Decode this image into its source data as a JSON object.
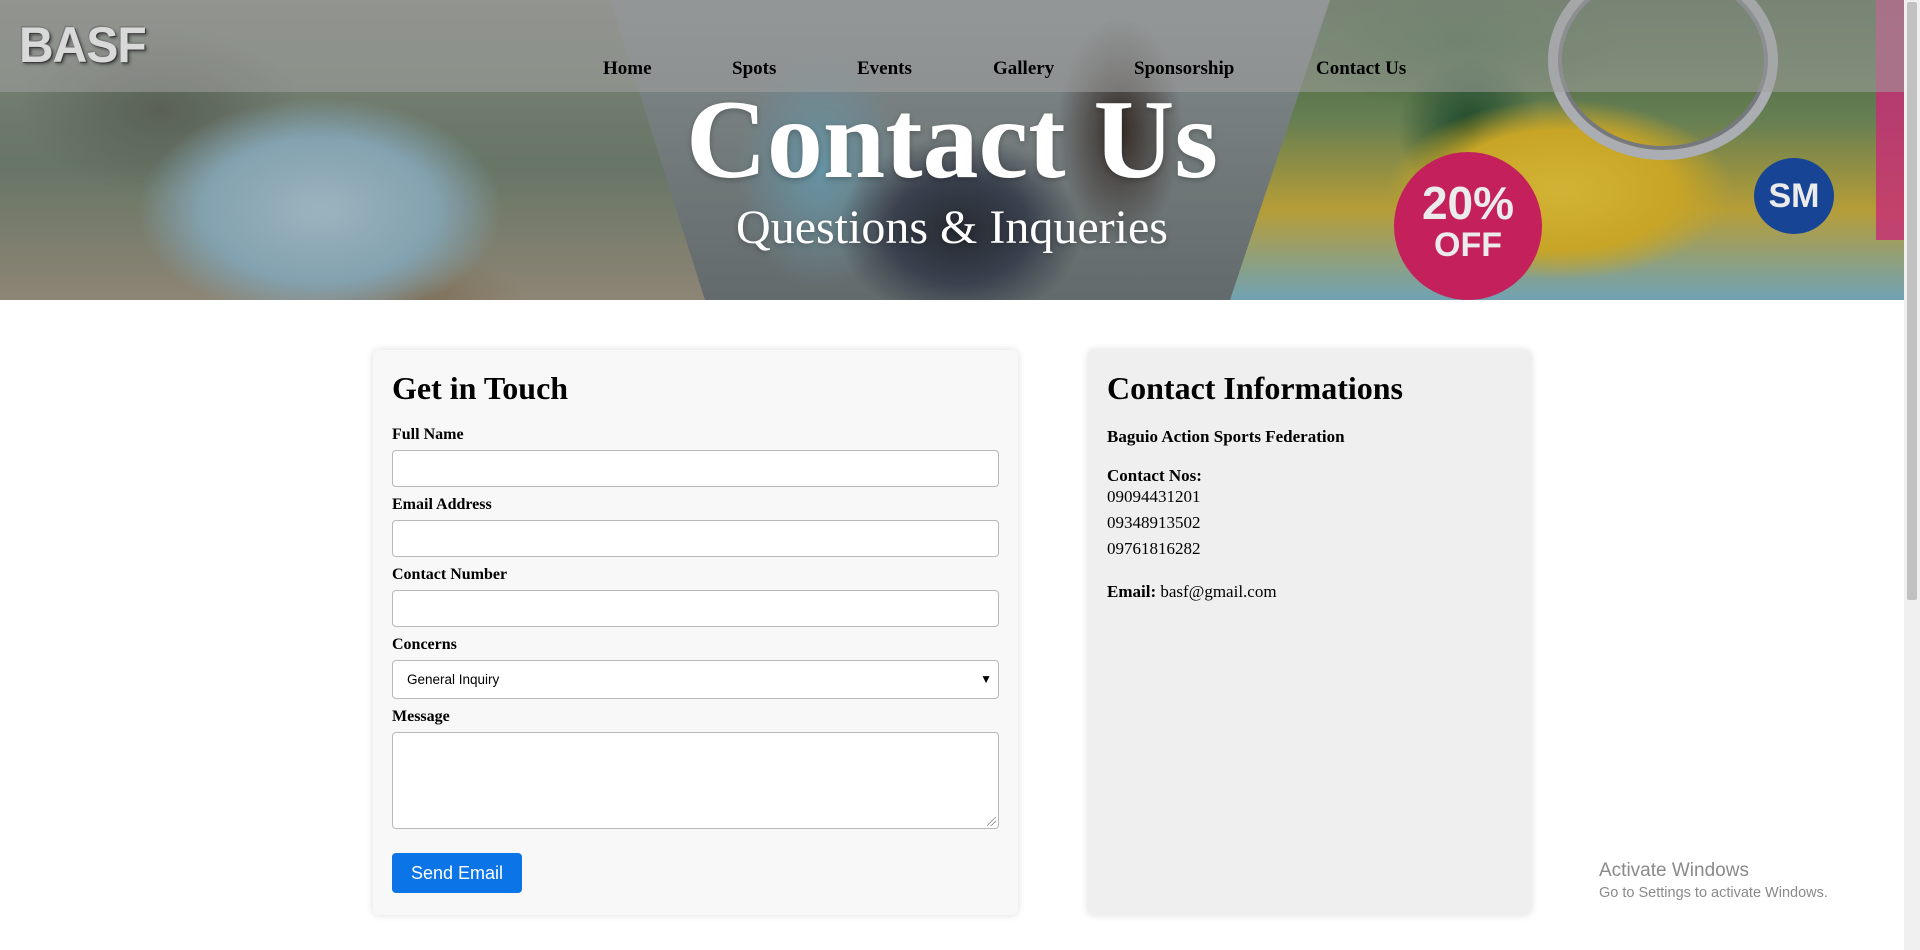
{
  "header": {
    "logo_text": "BASF",
    "nav": [
      {
        "label": "Home"
      },
      {
        "label": "Spots"
      },
      {
        "label": "Events"
      },
      {
        "label": "Gallery"
      },
      {
        "label": "Sponsorship"
      },
      {
        "label": "Contact Us"
      }
    ]
  },
  "hero": {
    "title": "Contact Us",
    "subtitle": "Questions & Inqueries",
    "banner_sale_top": "20%",
    "banner_sale_bottom": "OFF",
    "banner_badge": "SM"
  },
  "form": {
    "heading": "Get in Touch",
    "full_name_label": "Full Name",
    "full_name_value": "",
    "email_label": "Email Address",
    "email_value": "",
    "contact_label": "Contact Number",
    "contact_value": "",
    "concerns_label": "Concerns",
    "concerns_selected": "General Inquiry",
    "message_label": "Message",
    "message_value": "",
    "submit_label": "Send Email"
  },
  "info": {
    "heading": "Contact Informations",
    "organization": "Baguio Action Sports Federation",
    "contact_nos_label": "Contact Nos:",
    "numbers": [
      "09094431201",
      "09348913502",
      "09761816282"
    ],
    "email_label": "Email:",
    "email_value": "basf@gmail.com"
  },
  "watermark": {
    "title": "Activate Windows",
    "subtitle": "Go to Settings to activate Windows."
  },
  "colors": {
    "button": "#0b74e6",
    "form_bg": "#f8f8f8",
    "info_bg": "#efefef"
  }
}
